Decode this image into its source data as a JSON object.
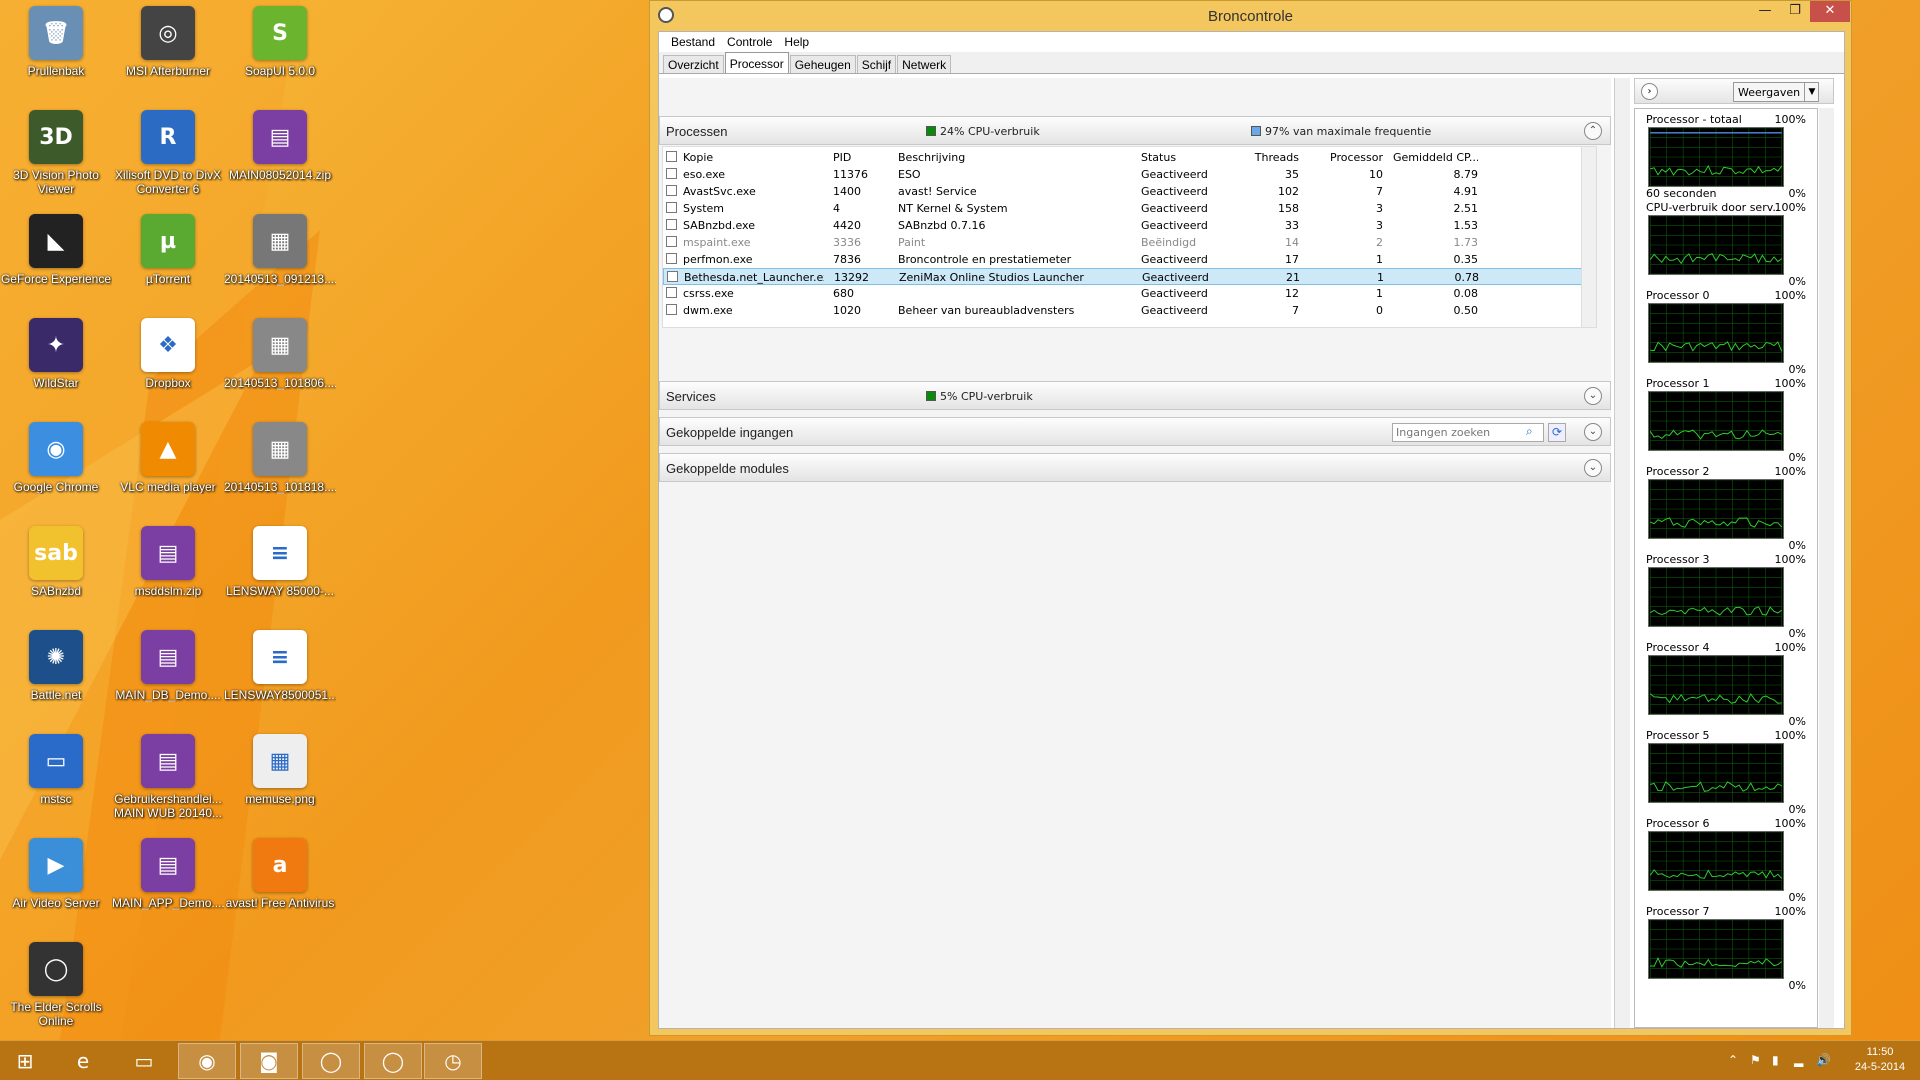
{
  "desktop": {
    "icons": [
      {
        "label": "Prullenbak",
        "icon": "recycle-bin-icon",
        "color": "#6a8fb5",
        "glyph": "🗑"
      },
      {
        "label": "MSI Afterburner",
        "icon": "msi-afterburner-icon",
        "color": "#444",
        "glyph": "◎"
      },
      {
        "label": "SoapUI 5.0.0",
        "icon": "soapui-icon",
        "color": "#6bb52e",
        "glyph": "S"
      },
      {
        "label": "3D Vision Photo Viewer",
        "icon": "3d-vision-icon",
        "color": "#3c5a2a",
        "glyph": "3D"
      },
      {
        "label": "Xilisoft DVD to DivX Converter 6",
        "icon": "xilisoft-icon",
        "color": "#2c6bc4",
        "glyph": "R"
      },
      {
        "label": "MAIN08052014.zip",
        "icon": "winrar-archive-icon",
        "color": "#7b3ea3",
        "glyph": "▤"
      },
      {
        "label": "GeForce Experience",
        "icon": "geforce-icon",
        "color": "#222",
        "glyph": "◣"
      },
      {
        "label": "µTorrent",
        "icon": "utorrent-icon",
        "color": "#5aa931",
        "glyph": "µ"
      },
      {
        "label": "20140513_091213....",
        "icon": "image-file-icon",
        "color": "#777",
        "glyph": "▦"
      },
      {
        "label": "WildStar",
        "icon": "wildstar-icon",
        "color": "#3a2a6a",
        "glyph": "✦"
      },
      {
        "label": "Dropbox",
        "icon": "dropbox-icon",
        "color": "#ffffff",
        "glyph": "❖"
      },
      {
        "label": "20140513_101806....",
        "icon": "image-file-icon",
        "color": "#888",
        "glyph": "▦"
      },
      {
        "label": "Google Chrome",
        "icon": "chrome-icon",
        "color": "#3b8ee0",
        "glyph": "◉"
      },
      {
        "label": "VLC media player",
        "icon": "vlc-icon",
        "color": "#f08a00",
        "glyph": "▲"
      },
      {
        "label": "20140513_101818....",
        "icon": "image-file-icon",
        "color": "#888",
        "glyph": "▦"
      },
      {
        "label": "SABnzbd",
        "icon": "sabnzbd-icon",
        "color": "#f2c12e",
        "glyph": "sab"
      },
      {
        "label": "msddslm.zip",
        "icon": "winrar-archive-icon",
        "color": "#7b3ea3",
        "glyph": "▤"
      },
      {
        "label": "LENSWAY 85000-...",
        "icon": "document-file-icon",
        "color": "#ffffff",
        "glyph": "≡"
      },
      {
        "label": "Battle.net",
        "icon": "battlenet-icon",
        "color": "#1d4f8a",
        "glyph": "✺"
      },
      {
        "label": "MAIN_DB_Demo....",
        "icon": "winrar-archive-icon",
        "color": "#7b3ea3",
        "glyph": "▤"
      },
      {
        "label": "LENSWAY8500051...",
        "icon": "document-file-icon",
        "color": "#ffffff",
        "glyph": "≡"
      },
      {
        "label": "mstsc",
        "icon": "remote-desktop-icon",
        "color": "#2a6ac9",
        "glyph": "▭"
      },
      {
        "label": "Gebruikershandlei... MAIN WUB 20140...",
        "icon": "winrar-archive-icon",
        "color": "#7b3ea3",
        "glyph": "▤"
      },
      {
        "label": "memuse.png",
        "icon": "image-file-icon",
        "color": "#eeeeee",
        "glyph": "▦"
      },
      {
        "label": "Air Video Server",
        "icon": "air-video-icon",
        "color": "#3a8fd8",
        "glyph": "▶"
      },
      {
        "label": "MAIN_APP_Demo....",
        "icon": "winrar-archive-icon",
        "color": "#7b3ea3",
        "glyph": "▤"
      },
      {
        "label": "avast! Free Antivirus",
        "icon": "avast-icon",
        "color": "#f07a10",
        "glyph": "a"
      },
      {
        "label": "The Elder Scrolls Online",
        "icon": "elder-scrolls-icon",
        "color": "#333",
        "glyph": "◯"
      }
    ]
  },
  "window": {
    "title": "Broncontrole",
    "min": "—",
    "max": "❐",
    "close": "✕"
  },
  "menu": [
    "Bestand",
    "Controle",
    "Help"
  ],
  "tabs": [
    "Overzicht",
    "Processor",
    "Geheugen",
    "Schijf",
    "Netwerk"
  ],
  "processes": {
    "title": "Processen",
    "cpu_usage": "24% CPU-verbruik",
    "max_freq": "97% van maximale frequentie",
    "columns": [
      "Kopie",
      "PID",
      "Beschrijving",
      "Status",
      "Threads",
      "Processor",
      "Gemiddeld CP..."
    ],
    "rows": [
      [
        "eso.exe",
        "11376",
        "ESO",
        "Geactiveerd",
        "35",
        "10",
        "8.79"
      ],
      [
        "AvastSvc.exe",
        "1400",
        "avast! Service",
        "Geactiveerd",
        "102",
        "7",
        "4.91"
      ],
      [
        "System",
        "4",
        "NT Kernel & System",
        "Geactiveerd",
        "158",
        "3",
        "2.51"
      ],
      [
        "SABnzbd.exe",
        "4420",
        "SABnzbd 0.7.16",
        "Geactiveerd",
        "33",
        "3",
        "1.53"
      ],
      [
        "mspaint.exe",
        "3336",
        "Paint",
        "Beëindigd",
        "14",
        "2",
        "1.73"
      ],
      [
        "perfmon.exe",
        "7836",
        "Broncontrole en prestatiemeter",
        "Geactiveerd",
        "17",
        "1",
        "0.35"
      ],
      [
        "Bethesda.net_Launcher.exe",
        "13292",
        "ZeniMax Online Studios Launcher",
        "Geactiveerd",
        "21",
        "1",
        "0.78"
      ],
      [
        "csrss.exe",
        "680",
        "",
        "Geactiveerd",
        "12",
        "1",
        "0.08"
      ],
      [
        "dwm.exe",
        "1020",
        "Beheer van bureaubladvensters",
        "Geactiveerd",
        "7",
        "0",
        "0.50"
      ]
    ]
  },
  "services": {
    "title": "Services",
    "cpu_usage": "5% CPU-verbruik"
  },
  "handles": {
    "title": "Gekoppelde ingangen",
    "search_placeholder": "Ingangen zoeken"
  },
  "modules": {
    "title": "Gekoppelde modules"
  },
  "rightpane": {
    "views_label": "Weergaven",
    "graphs": [
      {
        "name": "Processor - totaal",
        "max": "100%",
        "min": "0%",
        "sub": "60 seconden"
      },
      {
        "name": "CPU-verbruik door serv...",
        "max": "100%",
        "min": "0%",
        "sub": ""
      },
      {
        "name": "Processor 0",
        "max": "100%",
        "min": "0%",
        "sub": ""
      },
      {
        "name": "Processor 1",
        "max": "100%",
        "min": "0%",
        "sub": ""
      },
      {
        "name": "Processor 2",
        "max": "100%",
        "min": "0%",
        "sub": ""
      },
      {
        "name": "Processor 3",
        "max": "100%",
        "min": "0%",
        "sub": ""
      },
      {
        "name": "Processor 4",
        "max": "100%",
        "min": "0%",
        "sub": ""
      },
      {
        "name": "Processor 5",
        "max": "100%",
        "min": "0%",
        "sub": ""
      },
      {
        "name": "Processor 6",
        "max": "100%",
        "min": "0%",
        "sub": ""
      },
      {
        "name": "Processor 7",
        "max": "100%",
        "min": "0%",
        "sub": ""
      }
    ]
  },
  "taskbar": {
    "clock_time": "11:50",
    "clock_date": "24-5-2014",
    "apps": [
      {
        "name": "start-button",
        "icon": "windows-logo-icon",
        "glyph": "⊞"
      },
      {
        "name": "taskbar-ie",
        "icon": "internet-explorer-icon",
        "glyph": "e"
      },
      {
        "name": "taskbar-explorer",
        "icon": "folder-icon",
        "glyph": "▭"
      },
      {
        "name": "taskbar-chrome",
        "icon": "chrome-icon",
        "glyph": "◉"
      },
      {
        "name": "taskbar-app-red",
        "icon": "media-app-icon",
        "glyph": "◙"
      },
      {
        "name": "taskbar-eso-1",
        "icon": "elder-scrolls-icon",
        "glyph": "◯"
      },
      {
        "name": "taskbar-eso-2",
        "icon": "elder-scrolls-icon",
        "glyph": "◯"
      },
      {
        "name": "taskbar-resmon",
        "icon": "resource-monitor-icon",
        "glyph": "◷"
      }
    ]
  }
}
